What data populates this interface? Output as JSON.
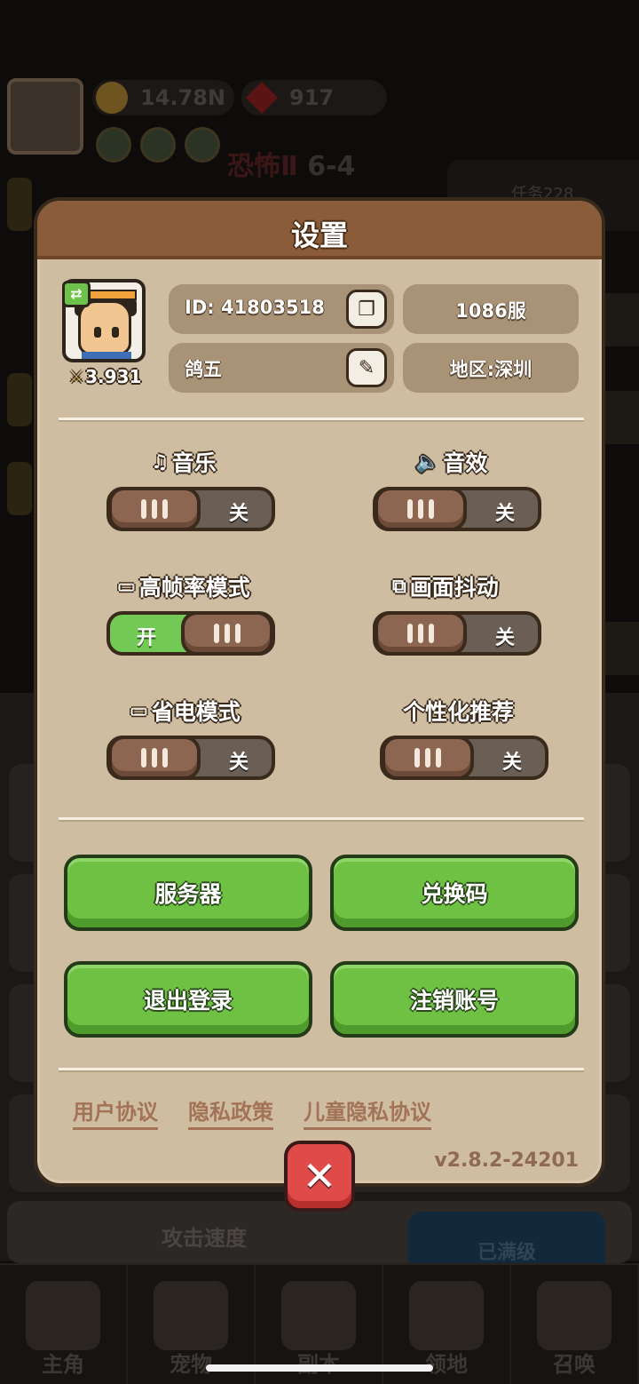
{
  "background": {
    "gold": "14.78N",
    "gems": "917",
    "stage_name": "恐怖Ⅱ",
    "stage_num": "6-4",
    "task": "任务228",
    "attack_speed": "攻击速度",
    "maxed": "已满级",
    "tabs": [
      "主角",
      "宠物",
      "副本",
      "领地",
      "召唤"
    ]
  },
  "dialog": {
    "title": "设置",
    "profile": {
      "power": "3.931",
      "id": "ID:  41803518",
      "server": "1086服",
      "name": "鸽五",
      "region": "地区:深圳"
    },
    "options": {
      "music": {
        "label": "音乐",
        "state": "关"
      },
      "sfx": {
        "label": "音效",
        "state": "关"
      },
      "high_fps": {
        "label": "高帧率模式",
        "state": "开"
      },
      "screen_shake": {
        "label": "画面抖动",
        "state": "关"
      },
      "power_save": {
        "label": "省电模式",
        "state": "关"
      },
      "personalized": {
        "label": "个性化推荐",
        "state": "关"
      }
    },
    "buttons": {
      "server": "服务器",
      "redeem": "兑换码",
      "logout": "退出登录",
      "delete_account": "注销账号"
    },
    "links": {
      "user_agreement": "用户协议",
      "privacy_policy": "隐私政策",
      "child_privacy": "儿童隐私协议"
    },
    "version": "v2.8.2-24201"
  },
  "colors": {
    "dialog_bg": "#cfbda1",
    "header": "#8a5c3a",
    "green_button": "#6fc144",
    "toggle_on": "#72c955",
    "close": "#e04a48",
    "link": "#a27357"
  }
}
